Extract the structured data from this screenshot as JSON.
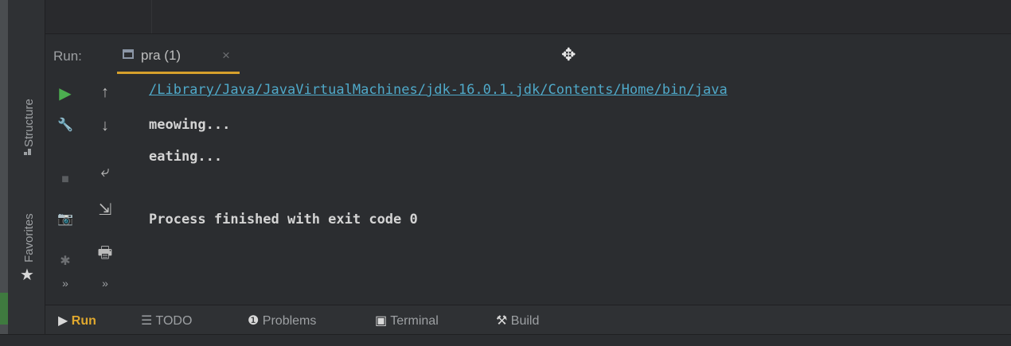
{
  "side": {
    "structure_label": "Structure",
    "favorites_label": "Favorites"
  },
  "run_panel": {
    "label": "Run:",
    "tab_label": "pra (1)",
    "tab_close": "×"
  },
  "toolbar": {
    "run_icon": "▶",
    "up_icon": "↑",
    "wrench_icon": "🔧",
    "down_icon": "↓",
    "stop_icon": "■",
    "soft_wrap_icon": "⤶",
    "scroll_end_icon": "⇲",
    "camera_icon": "📷",
    "print_icon": "🖶",
    "debug_icon": "✱",
    "more_left": "»",
    "more_right": "»"
  },
  "console": {
    "line1": "/Library/Java/JavaVirtualMachines/jdk-16.0.1.jdk/Contents/Home/bin/java",
    "line2": "meowing...",
    "line3": "eating...",
    "line4": "Process finished with exit code 0"
  },
  "bottom_tabs": [
    {
      "icon": "▶",
      "label": "Run"
    },
    {
      "icon": "☰",
      "label": "TODO"
    },
    {
      "icon": "❶",
      "label": "Problems"
    },
    {
      "icon": "▣",
      "label": "Terminal"
    },
    {
      "icon": "⚒",
      "label": "Build"
    }
  ],
  "colors": {
    "accent": "#d6a02c",
    "run_green": "#4caf50",
    "link": "#4fa9c9",
    "background": "#2b2d30"
  }
}
